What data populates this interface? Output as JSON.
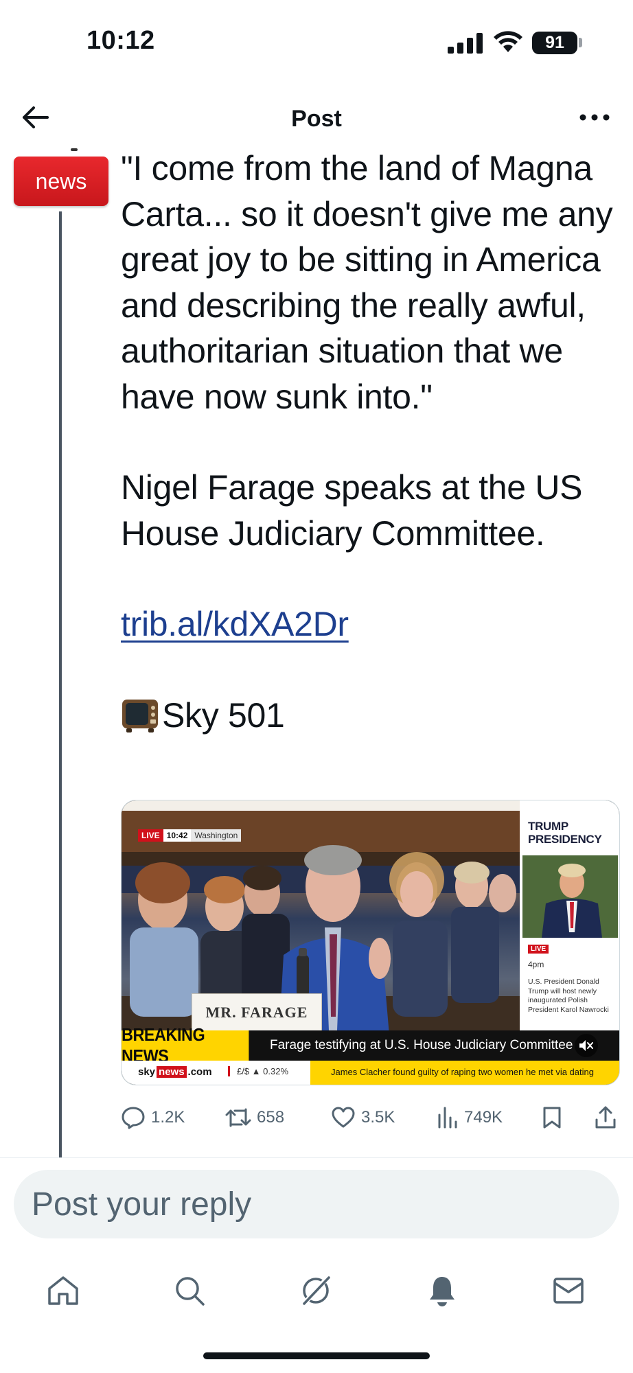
{
  "status_bar": {
    "time": "10:12",
    "battery": "91"
  },
  "header": {
    "title": "Post",
    "back_icon": "arrow-left-icon",
    "more_icon": "more-horizontal-icon"
  },
  "author": {
    "avatar_text": "news"
  },
  "post": {
    "quote": "\"I come from the land of Magna Carta... so it doesn't give me any great joy to be sitting in America and describing the really awful, authoritarian situation that we have now sunk into.\"",
    "body": "Nigel Farage speaks at the US House Judiciary Committee.",
    "link": "trib.al/kdXA2Dr",
    "channel": "Sky 501"
  },
  "media": {
    "live_label": "LIVE",
    "live_time": "10:42",
    "live_location": "Washington",
    "nameplate": "MR. FARAGE",
    "side_title": "TRUMP PRESIDENCY",
    "side_live": "LIVE",
    "side_time": "4pm",
    "side_text": "U.S. President Donald Trump will host newly inaugurated Polish President Karol Nawrocki",
    "breaking_label": "BREAKING NEWS",
    "breaking_text": "Farage testifying at U.S. House Judiciary Committee",
    "sky_logo_left": "sky",
    "sky_logo_mid": "news",
    "sky_logo_right": ".com",
    "fx_text": "£/$ ▲ 0.32%",
    "ticker_text": "James Clacher found guilty of raping two women he met via dating"
  },
  "actions": {
    "replies": "1.2K",
    "reposts": "658",
    "likes": "3.5K",
    "views": "749K"
  },
  "reply": {
    "placeholder": "Post your reply"
  },
  "nav": {
    "items": [
      "home-icon",
      "search-icon",
      "grok-icon",
      "notifications-icon",
      "messages-icon"
    ]
  },
  "colors": {
    "link": "#1d3f8f",
    "brand_red": "#d1111b",
    "breaking_yellow": "#ffd400",
    "muted": "#536471"
  }
}
